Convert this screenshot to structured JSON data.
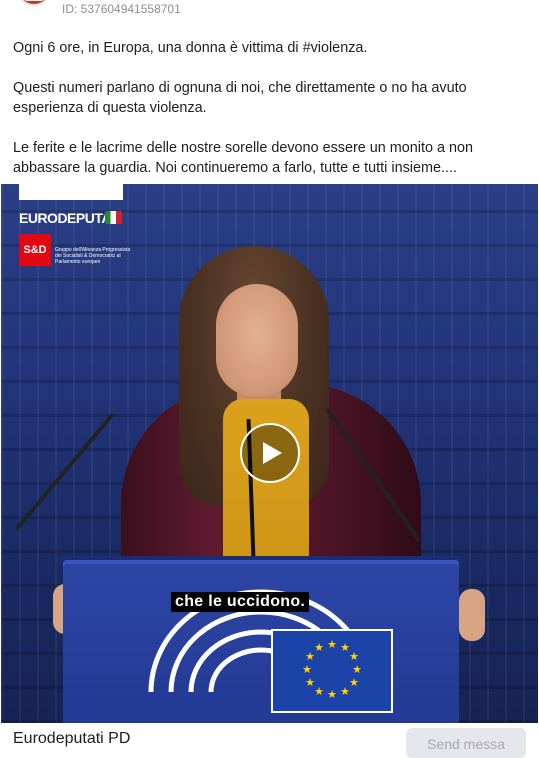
{
  "header": {
    "id_text": "ID: 537604941558701"
  },
  "post": {
    "paragraphs": [
      "Ogni 6 ore, in Europa, una donna è vittima di #violenza.",
      "Questi numeri parlano di ognuna di noi, che direttamente o no ha avuto esperienza di questa violenza.",
      "Le ferite e le lacrime delle nostre sorelle devono essere un monito a non abbassare la guardia. Noi continueremo a farlo, tutte e tutti insieme...."
    ]
  },
  "video": {
    "logo_text": "EURODEPUTATI",
    "sd_badge": "S&D",
    "sd_group_text": "Gruppo dell'Alleanza Progressista dei Socialisti & Democratici al Parlamento europeo",
    "subtitle": "che le uccidono.",
    "play_icon": "play-icon"
  },
  "footer": {
    "page_name": "Eurodeputati PD",
    "send_button": "Send messa"
  },
  "colors": {
    "accent_blue": "#22357a",
    "subtitle_bg": "#000000",
    "button_bg": "#e4e6eb"
  }
}
